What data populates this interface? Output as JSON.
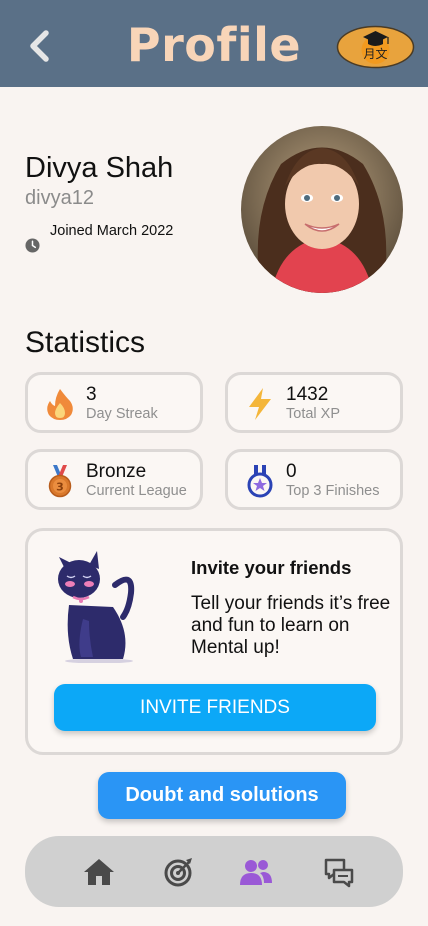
{
  "header": {
    "title": "Profile",
    "back_icon": "chevron-left-icon",
    "language_badge": {
      "icon": "graduation-cap-language-icon",
      "glyphs": "月文"
    }
  },
  "profile": {
    "name": "Divya Shah",
    "username": "divya12",
    "joined": "Joined March 2022"
  },
  "statistics": {
    "title": "Statistics",
    "cards": [
      {
        "icon": "fire-icon",
        "value": "3",
        "label": "Day Streak"
      },
      {
        "icon": "lightning-icon",
        "value": "1432",
        "label": "Total XP"
      },
      {
        "icon": "bronze-medal-icon",
        "value": "Bronze",
        "label": "Current League",
        "medal_number": "3"
      },
      {
        "icon": "medal-star-icon",
        "value": "0",
        "label": "Top 3 Finishes"
      }
    ]
  },
  "invite": {
    "title": "Invite your friends",
    "body": "Tell your friends it’s free and fun to learn on Mental up!",
    "button_label": "INVITE FRIENDS"
  },
  "doubt_button": {
    "label": "Doubt and solutions"
  },
  "bottom_nav": {
    "items": [
      {
        "icon": "home-icon",
        "active": false
      },
      {
        "icon": "target-icon",
        "active": false
      },
      {
        "icon": "friends-icon",
        "active": true
      },
      {
        "icon": "chat-help-icon",
        "active": false
      }
    ]
  },
  "colors": {
    "header_bg": "#5a7087",
    "title": "#f8d5b8",
    "primary_button": "#0ca8f7",
    "secondary_button": "#2a95f5",
    "nav_active": "#9a59d6",
    "nav_inactive": "#4a4a4a"
  }
}
